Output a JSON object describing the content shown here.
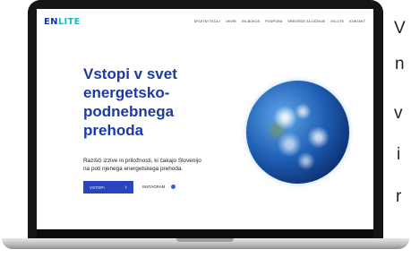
{
  "brand": {
    "logo_en": "EN",
    "logo_lite": "LITE"
  },
  "nav": {
    "items": [
      "SPLETNI TEČAJ",
      "OKVIR",
      "EN-BOKOS",
      "PODPORA",
      "SREDIŠČE ZA UČENJE",
      "EN-LITE",
      "KONTAKT"
    ]
  },
  "hero": {
    "title": "Vstopi v svet\nenergetsko-\npodnebnega\nprehoda",
    "text": "Razišči izzive in priložnosti, ki čakajo Slovenijo\nna poti njenega energetskega prehoda.",
    "cta_label": "VSTOPI",
    "cta_arrow": "›",
    "instagram_label": "INSTAGRAM"
  },
  "side_text": [
    "V",
    "n",
    "v",
    "i",
    "r"
  ],
  "colors": {
    "brand_blue": "#1b3aa6",
    "button_blue": "#2a44c0",
    "logo_accent": "#19b9c7"
  }
}
